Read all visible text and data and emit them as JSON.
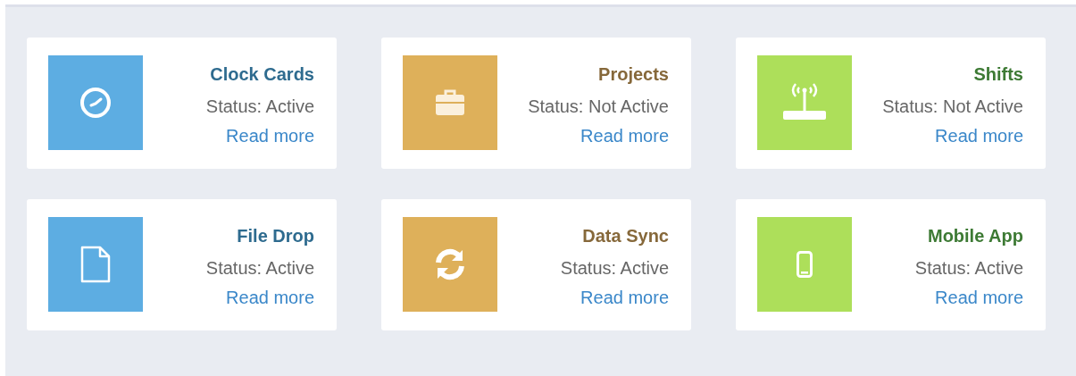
{
  "cards": [
    {
      "kind": "clock",
      "color": "#5dade2",
      "title": "Clock Cards",
      "status": "Status: Active",
      "link": "Read more"
    },
    {
      "kind": "briefcase",
      "color": "#deb05a",
      "title": "Projects",
      "status": "Status: Not Active",
      "link": "Read more"
    },
    {
      "kind": "router",
      "color": "#addf5a",
      "title": "Shifts",
      "status": "Status: Not Active",
      "link": "Read more"
    },
    {
      "kind": "file",
      "color": "#5dade2",
      "title": "File Drop",
      "status": "Status: Active",
      "link": "Read more"
    },
    {
      "kind": "sync",
      "color": "#deb05a",
      "title": "Data Sync",
      "status": "Status: Active",
      "link": "Read more"
    },
    {
      "kind": "phone",
      "color": "#addf5a",
      "title": "Mobile App",
      "status": "Status: Active",
      "link": "Read more"
    }
  ]
}
